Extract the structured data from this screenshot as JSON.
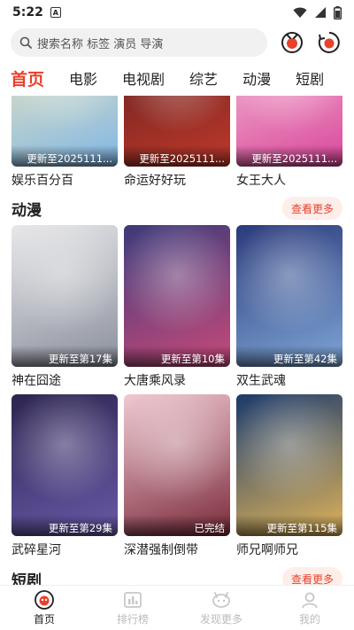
{
  "status_bar": {
    "time": "5:22",
    "notif_glyph": "A"
  },
  "search": {
    "placeholder": "搜索名称 标签 演员 导演"
  },
  "header_icons": [
    "history-icon",
    "download-icon"
  ],
  "tabs": [
    {
      "label": "首页",
      "active": true
    },
    {
      "label": "电影"
    },
    {
      "label": "电视剧"
    },
    {
      "label": "综艺"
    },
    {
      "label": "动漫"
    },
    {
      "label": "短剧"
    }
  ],
  "variety_row": [
    {
      "title": "娱乐百分百",
      "badge": "更新至2025111...",
      "colors": [
        "#f5e9b8",
        "#7fb6e6"
      ]
    },
    {
      "title": "命运好好玩",
      "badge": "更新至2025111...",
      "colors": [
        "#5a1d1d",
        "#c0392b"
      ]
    },
    {
      "title": "女王大人",
      "badge": "更新至2025111...",
      "colors": [
        "#f7c8dc",
        "#d9469a"
      ]
    }
  ],
  "anime_section": {
    "name": "动漫",
    "more_label": "查看更多",
    "items": [
      {
        "title": "神在囧途",
        "badge": "更新至第17集",
        "colors": [
          "#e8e8ea",
          "#8a8f9c"
        ]
      },
      {
        "title": "大唐乘风录",
        "badge": "更新至第10集",
        "colors": [
          "#3b3a7a",
          "#c94a7a"
        ]
      },
      {
        "title": "双生武魂",
        "badge": "更新至第42集",
        "colors": [
          "#2a3a7a",
          "#7fa6d6"
        ]
      },
      {
        "title": "武碎星河",
        "badge": "更新至第29集",
        "colors": [
          "#2c2450",
          "#6a5aa8"
        ]
      },
      {
        "title": "深潜强制倒带",
        "badge": "已完结",
        "colors": [
          "#f0c9d2",
          "#7a2a3a"
        ]
      },
      {
        "title": "师兄啊师兄",
        "badge": "更新至第115集",
        "colors": [
          "#1a3a6a",
          "#e0b45a"
        ]
      }
    ]
  },
  "shortdrama_section": {
    "name": "短剧",
    "more_label": "查看更多"
  },
  "bottom_nav": [
    {
      "label": "首页",
      "icon": "home-icon",
      "active": true
    },
    {
      "label": "排行榜",
      "icon": "ranking-icon"
    },
    {
      "label": "发现更多",
      "icon": "discover-icon"
    },
    {
      "label": "我的",
      "icon": "profile-icon"
    }
  ],
  "colors": {
    "accent": "#e8412c",
    "more_bg": "#fdeeea"
  }
}
